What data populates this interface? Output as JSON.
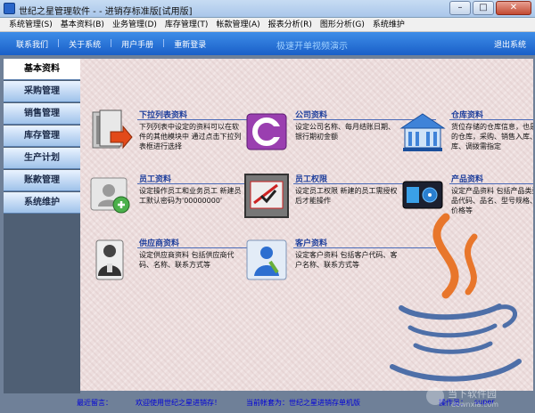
{
  "window": {
    "title": "世纪之星管理软件 - - 进销存标准版[试用版]",
    "buttons": {
      "minimize": "–",
      "maximize": "□",
      "close": "✕"
    }
  },
  "menubar": [
    "系统管理(S)",
    "基本资料(B)",
    "业务管理(D)",
    "库存管理(T)",
    "帐款管理(A)",
    "报表分析(R)",
    "图形分析(G)",
    "系统维护"
  ],
  "topnav": {
    "links": [
      "联系我们",
      "关于系统",
      "用户手册",
      "重新登录"
    ],
    "center": "极速开单视频演示",
    "exit": "退出系统"
  },
  "sidebar": {
    "items": [
      "基本资料",
      "采购管理",
      "销售管理",
      "库存管理",
      "生产计划",
      "账款管理",
      "系统维护"
    ],
    "active_index": 0
  },
  "cards": [
    {
      "title": "下拉列表资料",
      "desc": "下列列表中设定的资料可以在软件的其他模块中 通过点击下拉列表框进行选择",
      "icon": "dropdown-list-icon"
    },
    {
      "title": "公司资料",
      "desc": "设定公司名称、每月结账日期、银行期初金额",
      "icon": "company-icon"
    },
    {
      "title": "仓库资料",
      "desc": "货位存储的仓库信息，也是虚拟的仓库，采购、销售入库、出库、调拨需指定",
      "icon": "warehouse-icon"
    },
    {
      "title": "员工资料",
      "desc": "设定操作员工和业务员工 新建员工默认密码为'00000000'",
      "icon": "employee-icon"
    },
    {
      "title": "员工权限",
      "desc": "设定员工权限 新建的员工需授权后才能操作",
      "icon": "permission-icon"
    },
    {
      "title": "产品资料",
      "desc": "设定产品资料 包括产品类型、产品代码、品名、型号规格、指导价格等",
      "icon": "product-icon"
    },
    {
      "title": "供应商资料",
      "desc": "设定供应商资料 包括供应商代码、名称、联系方式等",
      "icon": "supplier-icon"
    },
    {
      "title": "客户资料",
      "desc": "设定客户资料 包括客户代码、客户名称、联系方式等",
      "icon": "customer-icon"
    }
  ],
  "footer": {
    "label": "最近留言：",
    "welcome": "欢迎使用世纪之星进销存！",
    "account": "当前帐套为：世纪之星进销存单机版",
    "operator_label": "操作员：",
    "operator": "super"
  },
  "watermark": {
    "text": "当下软件园",
    "sub": "downxia.com"
  },
  "colors": {
    "nav": "#1a5fc8",
    "accent_title": "#1f3f9c",
    "content_bg": "#eddede",
    "java_orange": "#e8762b",
    "java_blue": "#4e6fa8"
  }
}
